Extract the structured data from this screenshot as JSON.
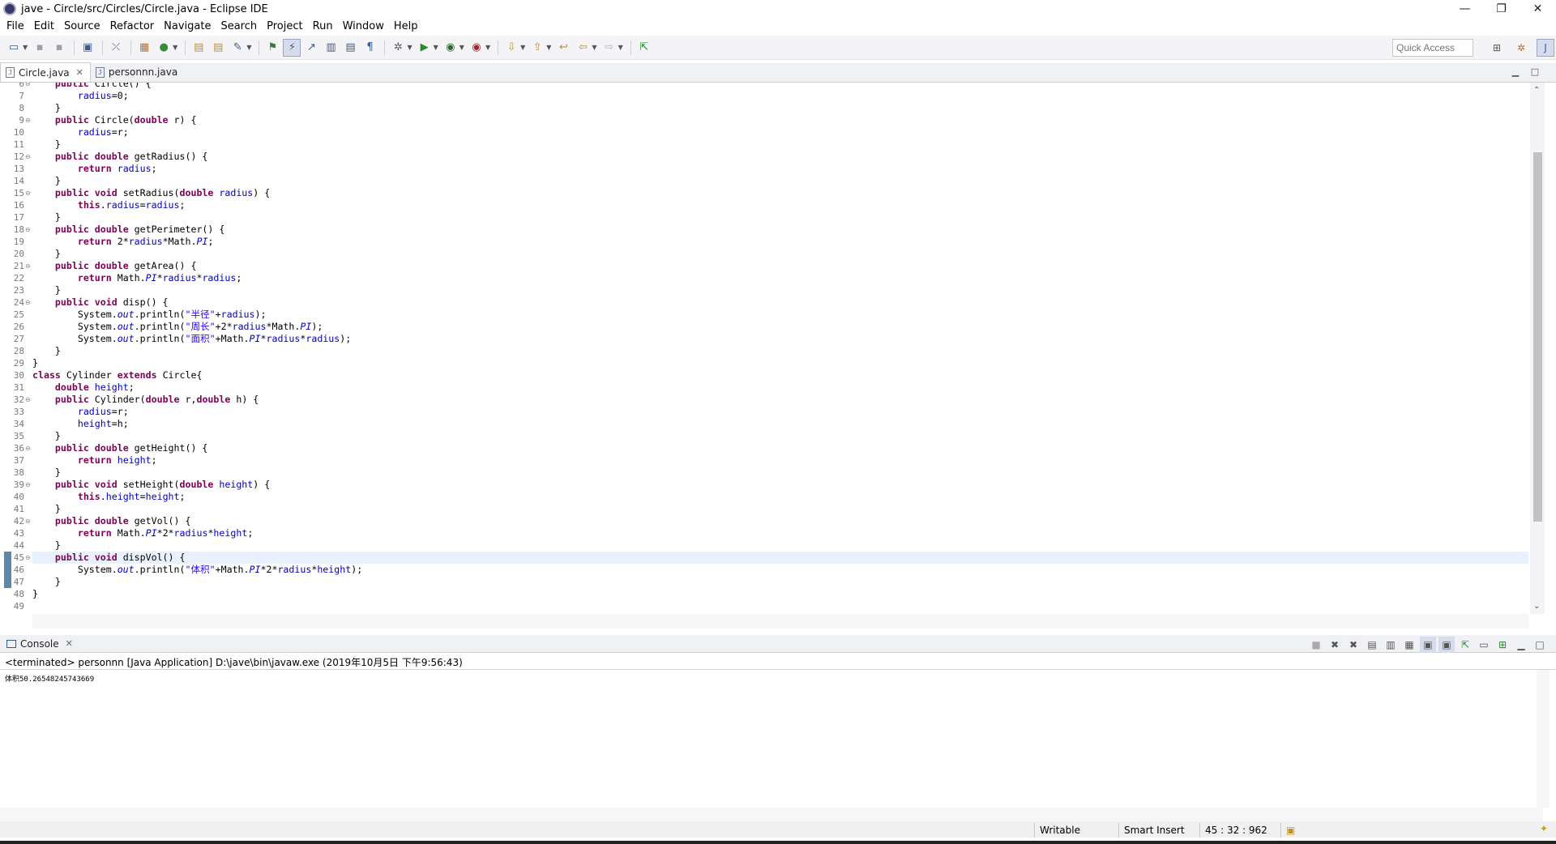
{
  "window": {
    "title": "jave - Circle/src/Circles/Circle.java - Eclipse IDE",
    "minimize": "—",
    "maximize": "❐",
    "close": "✕"
  },
  "menu": [
    "File",
    "Edit",
    "Source",
    "Refactor",
    "Navigate",
    "Search",
    "Project",
    "Run",
    "Window",
    "Help"
  ],
  "toolbar": {
    "quick_access_placeholder": "Quick Access"
  },
  "editor_tabs": [
    {
      "label": "Circle.java",
      "active": true,
      "close": "✕"
    },
    {
      "label": "personnn.java",
      "active": false
    }
  ],
  "editor": {
    "current_line": 45,
    "change_lines": [
      45,
      47
    ],
    "fold_lines": [
      6,
      9,
      12,
      15,
      18,
      21,
      24,
      32,
      36,
      39,
      42,
      45
    ],
    "lines": [
      {
        "n": "6",
        "code": "\tpublic Circle() {"
      },
      {
        "n": "7",
        "code": "\t\tradius=0;"
      },
      {
        "n": "8",
        "code": "\t}"
      },
      {
        "n": "9",
        "code": "\tpublic Circle(double r) {"
      },
      {
        "n": "10",
        "code": "\t\tradius=r;"
      },
      {
        "n": "11",
        "code": "\t}"
      },
      {
        "n": "12",
        "code": "\tpublic double getRadius() {"
      },
      {
        "n": "13",
        "code": "\t\treturn radius;"
      },
      {
        "n": "14",
        "code": "\t}"
      },
      {
        "n": "15",
        "code": "\tpublic void setRadius(double radius) {"
      },
      {
        "n": "16",
        "code": "\t\tthis.radius=radius;"
      },
      {
        "n": "17",
        "code": "\t}"
      },
      {
        "n": "18",
        "code": "\tpublic double getPerimeter() {"
      },
      {
        "n": "19",
        "code": "\t\treturn 2*radius*Math.PI;"
      },
      {
        "n": "20",
        "code": "\t}"
      },
      {
        "n": "21",
        "code": "\tpublic double getArea() {"
      },
      {
        "n": "22",
        "code": "\t\treturn Math.PI*radius*radius;"
      },
      {
        "n": "23",
        "code": "\t}"
      },
      {
        "n": "24",
        "code": "\tpublic void disp() {"
      },
      {
        "n": "25",
        "code": "\t\tSystem.out.println(\"半径\"+radius);"
      },
      {
        "n": "26",
        "code": "\t\tSystem.out.println(\"周长\"+2*radius*Math.PI);"
      },
      {
        "n": "27",
        "code": "\t\tSystem.out.println(\"面积\"+Math.PI*radius*radius);"
      },
      {
        "n": "28",
        "code": "\t}"
      },
      {
        "n": "29",
        "code": "}"
      },
      {
        "n": "30",
        "code": "class Cylinder extends Circle{"
      },
      {
        "n": "31",
        "code": "\tdouble height;"
      },
      {
        "n": "32",
        "code": "\tpublic Cylinder(double r,double h) {"
      },
      {
        "n": "33",
        "code": "\t\tradius=r;"
      },
      {
        "n": "34",
        "code": "\t\theight=h;"
      },
      {
        "n": "35",
        "code": "\t}"
      },
      {
        "n": "36",
        "code": "\tpublic double getHeight() {"
      },
      {
        "n": "37",
        "code": "\t\treturn height;"
      },
      {
        "n": "38",
        "code": "\t}"
      },
      {
        "n": "39",
        "code": "\tpublic void setHeight(double height) {"
      },
      {
        "n": "40",
        "code": "\t\tthis.height=height;"
      },
      {
        "n": "41",
        "code": "\t}"
      },
      {
        "n": "42",
        "code": "\tpublic double getVol() {"
      },
      {
        "n": "43",
        "code": "\t\treturn Math.PI*2*radius*height;"
      },
      {
        "n": "44",
        "code": "\t}"
      },
      {
        "n": "45",
        "code": "\tpublic void dispVol() {"
      },
      {
        "n": "46",
        "code": "\t\tSystem.out.println(\"体积\"+Math.PI*2*radius*height);"
      },
      {
        "n": "47",
        "code": "\t}"
      },
      {
        "n": "48",
        "code": "}"
      },
      {
        "n": "49",
        "code": ""
      }
    ],
    "keywords": [
      "public",
      "void",
      "double",
      "return",
      "this",
      "class",
      "extends"
    ],
    "fields": [
      "radius",
      "height"
    ],
    "static_fields": [
      "PI",
      "out"
    ]
  },
  "console": {
    "tab_label": "Console",
    "tab_close": "✕",
    "status": "<terminated> personnn [Java Application] D:\\jave\\bin\\javaw.exe (2019年10月5日 下午9:56:43)",
    "output": "体积50.26548245743669"
  },
  "statusbar": {
    "writable": "Writable",
    "insert_mode": "Smart Insert",
    "position": "45 : 32 : 962"
  },
  "colors": {
    "keyword": "#7f0055",
    "field": "#0000c0",
    "string": "#2a00ff",
    "current_line": "#e8f2fe",
    "change_bar": "#5b89a8"
  }
}
